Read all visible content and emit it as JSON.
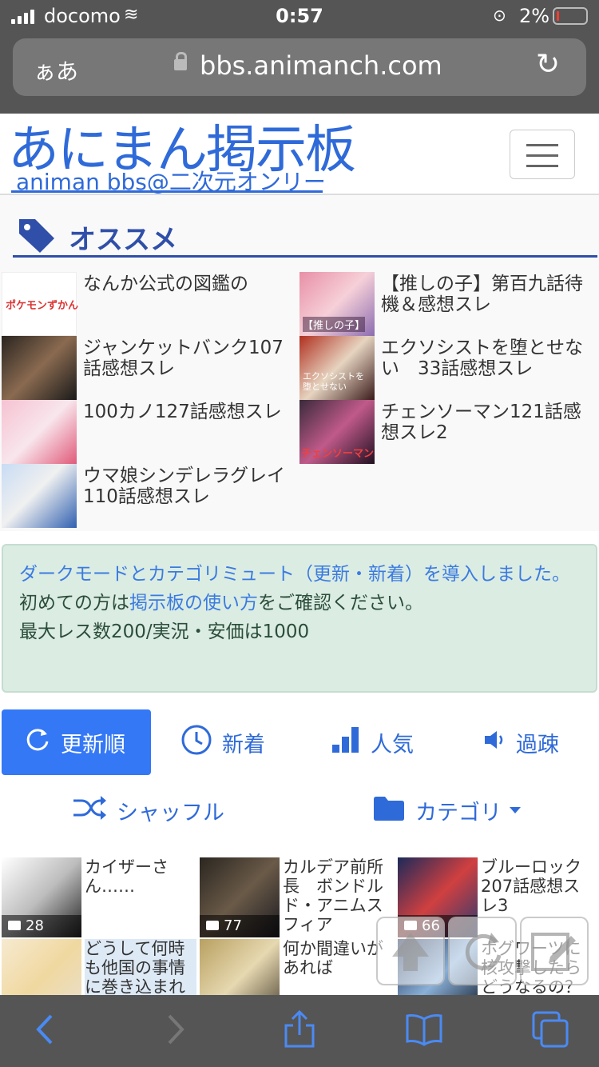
{
  "status": {
    "carrier": "docomo",
    "time": "0:57",
    "battery": "2%"
  },
  "browser": {
    "aa": "ぁあ",
    "url": "bbs.animanch.com"
  },
  "site": {
    "title": "あにまん掲示板",
    "subtitle": "animan bbs@二次元オンリー"
  },
  "osusume": {
    "heading": "オススメ",
    "items": [
      {
        "label": "なんか公式の図鑑の",
        "thumb_text": "ポケモンずかん",
        "thumb_color": "#ffffff"
      },
      {
        "label": "【推しの子】第百九話待機＆感想スレ",
        "thumb_text": "【推しの子】",
        "thumb_color": "#e8a0b0"
      },
      {
        "label": "ジャンケットバンク107話感想スレ",
        "thumb_text": "",
        "thumb_color": "#5a4a3a"
      },
      {
        "label": "エクソシストを堕とせない　33話感想スレ",
        "thumb_text": "エクソシストを堕とせない",
        "thumb_color": "#7a3a30"
      },
      {
        "label": "100カノ127話感想スレ",
        "thumb_text": "",
        "thumb_color": "#e9b4c8"
      },
      {
        "label": "チェンソーマン121話感想スレ2",
        "thumb_text": "チェンソーマン",
        "thumb_color": "#8a4a6a"
      },
      {
        "label": "ウマ娘シンデレラグレイ　110話感想スレ",
        "thumb_text": "",
        "thumb_color": "#9ac0e8"
      }
    ]
  },
  "notice": {
    "line1": "ダークモードとカテゴリミュート（更新・新着）を導入しました。",
    "line2_pre": "初めての方は",
    "line2_link": "掲示板の使い方",
    "line2_post": "をご確認ください。",
    "line3": "最大レス数200/実況・安価は1000"
  },
  "tabs": {
    "update": "更新順",
    "new": "新着",
    "popular": "人気",
    "old": "過疎",
    "shuffle": "シャッフル",
    "category": "カテゴリ"
  },
  "threads": [
    {
      "title": "カイザーさん……",
      "count": "28",
      "thumb_color": "#f0f0f0"
    },
    {
      "title": "カルデア前所長　ボンドルド・アニムスフィア",
      "count": "77",
      "thumb_color": "#3a3530"
    },
    {
      "title": "ブルーロック207話感想スレ3",
      "count": "66",
      "thumb_color": "#3a4a80"
    },
    {
      "title": "どうして何時も他国の事情に巻き込まれ",
      "count": "",
      "thumb_color": "#f3e4c8"
    },
    {
      "title": "何か間違いがあれば",
      "count": "",
      "thumb_color": "#d8c89a"
    },
    {
      "title": "ホグワーツに核攻撃したらどうなるの？",
      "count": "",
      "thumb_color": "#2a3a5a"
    }
  ]
}
